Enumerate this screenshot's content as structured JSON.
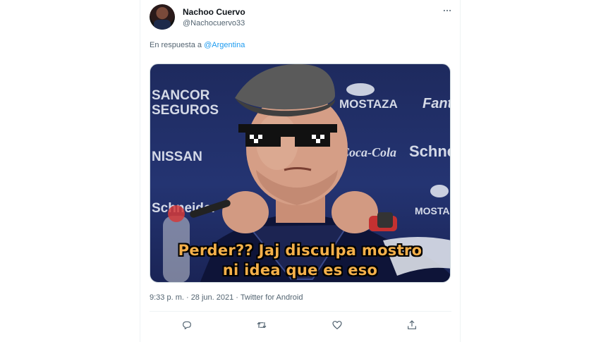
{
  "tweet": {
    "display_name": "Nachoo Cuervo",
    "handle": "@Nachocuervo33",
    "reply_prefix": "En respuesta a",
    "reply_mention": "@Argentina",
    "timestamp": "9:33 p. m. · 28 jun. 2021 · Twitter for Android"
  },
  "media": {
    "caption_line_1": "Perder?? Jaj disculpa mostro",
    "caption_line_2": "ni idea que es eso",
    "backdrop_logos": [
      "SANCOR",
      "SEGUROS",
      "NISSAN",
      "Schneider",
      "MOSTAZA",
      "Coca-Cola",
      "Schne",
      "Fanta",
      "MOSTAZA"
    ]
  },
  "icons": {
    "more": "more-horizontal-icon",
    "reply": "reply-icon",
    "retweet": "retweet-icon",
    "like": "heart-icon",
    "share": "share-icon"
  },
  "colors": {
    "text_primary": "#0f1419",
    "text_secondary": "#536471",
    "link": "#1d9bf0",
    "caption": "#f4b04a"
  }
}
